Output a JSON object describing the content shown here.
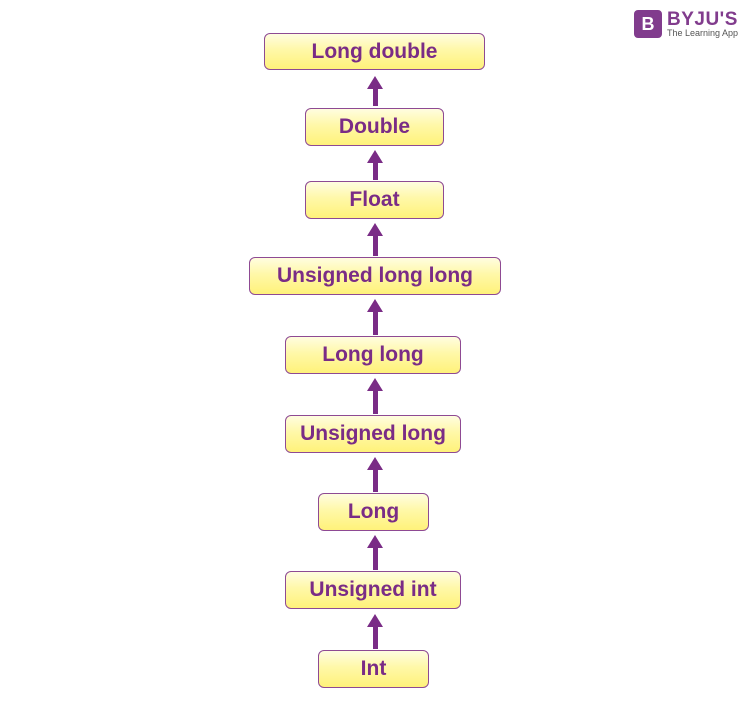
{
  "logo": {
    "mark": "B",
    "name": "BYJU'S",
    "tagline": "The Learning App"
  },
  "colors": {
    "text": "#7a2c86",
    "border": "#8e4a93",
    "fill": "#fff27a",
    "arrow": "#7a2c86"
  },
  "hierarchy": [
    "Long double",
    "Double",
    "Float",
    "Unsigned long long",
    "Long long",
    "Unsigned long",
    "Long",
    "Unsigned int",
    "Int"
  ]
}
